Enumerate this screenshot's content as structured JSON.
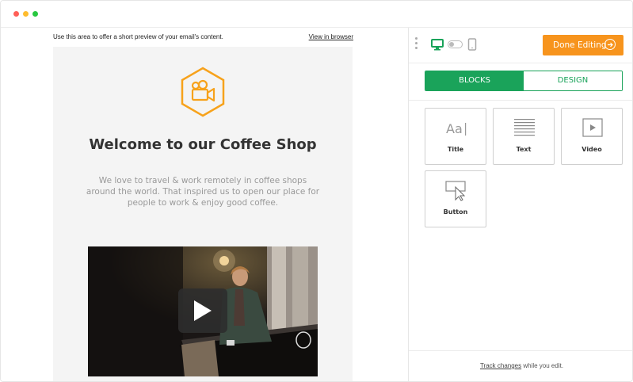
{
  "window": {
    "controls": [
      "close",
      "minimize",
      "maximize"
    ]
  },
  "preview": {
    "preheader_text": "Use this area to offer a short preview of your email's content.",
    "view_in_browser": "View in browser",
    "logo_icon": "video-camera-hexagon-icon",
    "title": "Welcome to our Coffee Shop",
    "body": "We love to travel & work remotely in coffee shops around the world. That inspired us to open our place for people to work & enjoy good coffee.",
    "video_play_icon": "play-icon"
  },
  "panel": {
    "done_label": "Done Editing",
    "tabs": [
      {
        "label": "BLOCKS",
        "active": true
      },
      {
        "label": "DESIGN",
        "active": false
      }
    ],
    "blocks": [
      {
        "label": "Title",
        "icon": "title-icon",
        "glyph": "Aa"
      },
      {
        "label": "Text",
        "icon": "text-icon"
      },
      {
        "label": "Video",
        "icon": "video-icon"
      },
      {
        "label": "Button",
        "icon": "button-icon"
      }
    ],
    "footer_link": "Track changes",
    "footer_rest": " while you edit."
  },
  "colors": {
    "accent_orange": "#f7941d",
    "accent_green": "#1aa35a"
  }
}
